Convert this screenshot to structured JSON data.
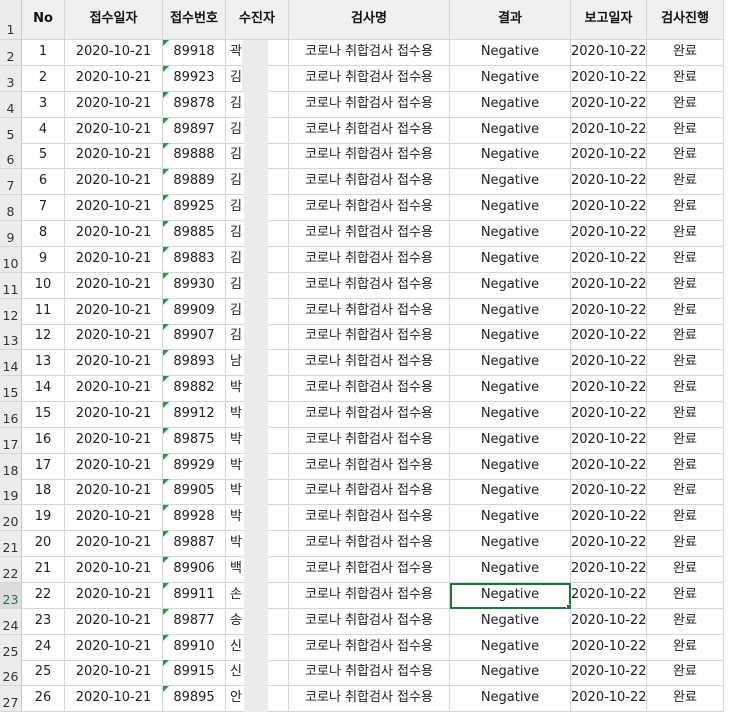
{
  "columns": [
    "No",
    "접수일자",
    "접수번호",
    "수진자",
    "검사명",
    "결과",
    "보고일자",
    "검사진행"
  ],
  "header_row_number": "1",
  "selected_row_number": "23",
  "active_cell": {
    "row": 22,
    "column": "결과"
  },
  "rows": [
    {
      "rownum": "2",
      "no": "1",
      "date": "2020-10-21",
      "id": "89918",
      "name": "곽",
      "test": "코로나 취합검사 접수용",
      "result": "Negative",
      "report": "2020-10-22",
      "status": "완료"
    },
    {
      "rownum": "3",
      "no": "2",
      "date": "2020-10-21",
      "id": "89923",
      "name": "김",
      "test": "코로나 취합검사 접수용",
      "result": "Negative",
      "report": "2020-10-22",
      "status": "완료"
    },
    {
      "rownum": "4",
      "no": "3",
      "date": "2020-10-21",
      "id": "89878",
      "name": "김",
      "test": "코로나 취합검사 접수용",
      "result": "Negative",
      "report": "2020-10-22",
      "status": "완료"
    },
    {
      "rownum": "5",
      "no": "4",
      "date": "2020-10-21",
      "id": "89897",
      "name": "김",
      "test": "코로나 취합검사 접수용",
      "result": "Negative",
      "report": "2020-10-22",
      "status": "완료"
    },
    {
      "rownum": "6",
      "no": "5",
      "date": "2020-10-21",
      "id": "89888",
      "name": "김",
      "test": "코로나 취합검사 접수용",
      "result": "Negative",
      "report": "2020-10-22",
      "status": "완료"
    },
    {
      "rownum": "7",
      "no": "6",
      "date": "2020-10-21",
      "id": "89889",
      "name": "김",
      "test": "코로나 취합검사 접수용",
      "result": "Negative",
      "report": "2020-10-22",
      "status": "완료"
    },
    {
      "rownum": "8",
      "no": "7",
      "date": "2020-10-21",
      "id": "89925",
      "name": "김",
      "test": "코로나 취합검사 접수용",
      "result": "Negative",
      "report": "2020-10-22",
      "status": "완료"
    },
    {
      "rownum": "9",
      "no": "8",
      "date": "2020-10-21",
      "id": "89885",
      "name": "김",
      "test": "코로나 취합검사 접수용",
      "result": "Negative",
      "report": "2020-10-22",
      "status": "완료"
    },
    {
      "rownum": "10",
      "no": "9",
      "date": "2020-10-21",
      "id": "89883",
      "name": "김",
      "test": "코로나 취합검사 접수용",
      "result": "Negative",
      "report": "2020-10-22",
      "status": "완료"
    },
    {
      "rownum": "11",
      "no": "10",
      "date": "2020-10-21",
      "id": "89930",
      "name": "김",
      "test": "코로나 취합검사 접수용",
      "result": "Negative",
      "report": "2020-10-22",
      "status": "완료"
    },
    {
      "rownum": "12",
      "no": "11",
      "date": "2020-10-21",
      "id": "89909",
      "name": "김",
      "test": "코로나 취합검사 접수용",
      "result": "Negative",
      "report": "2020-10-22",
      "status": "완료"
    },
    {
      "rownum": "13",
      "no": "12",
      "date": "2020-10-21",
      "id": "89907",
      "name": "김",
      "test": "코로나 취합검사 접수용",
      "result": "Negative",
      "report": "2020-10-22",
      "status": "완료"
    },
    {
      "rownum": "14",
      "no": "13",
      "date": "2020-10-21",
      "id": "89893",
      "name": "남",
      "test": "코로나 취합검사 접수용",
      "result": "Negative",
      "report": "2020-10-22",
      "status": "완료"
    },
    {
      "rownum": "15",
      "no": "14",
      "date": "2020-10-21",
      "id": "89882",
      "name": "박",
      "test": "코로나 취합검사 접수용",
      "result": "Negative",
      "report": "2020-10-22",
      "status": "완료"
    },
    {
      "rownum": "16",
      "no": "15",
      "date": "2020-10-21",
      "id": "89912",
      "name": "박",
      "test": "코로나 취합검사 접수용",
      "result": "Negative",
      "report": "2020-10-22",
      "status": "완료"
    },
    {
      "rownum": "17",
      "no": "16",
      "date": "2020-10-21",
      "id": "89875",
      "name": "박",
      "test": "코로나 취합검사 접수용",
      "result": "Negative",
      "report": "2020-10-22",
      "status": "완료"
    },
    {
      "rownum": "18",
      "no": "17",
      "date": "2020-10-21",
      "id": "89929",
      "name": "박",
      "test": "코로나 취합검사 접수용",
      "result": "Negative",
      "report": "2020-10-22",
      "status": "완료"
    },
    {
      "rownum": "19",
      "no": "18",
      "date": "2020-10-21",
      "id": "89905",
      "name": "박",
      "test": "코로나 취합검사 접수용",
      "result": "Negative",
      "report": "2020-10-22",
      "status": "완료"
    },
    {
      "rownum": "20",
      "no": "19",
      "date": "2020-10-21",
      "id": "89928",
      "name": "박",
      "test": "코로나 취합검사 접수용",
      "result": "Negative",
      "report": "2020-10-22",
      "status": "완료"
    },
    {
      "rownum": "21",
      "no": "20",
      "date": "2020-10-21",
      "id": "89887",
      "name": "박",
      "test": "코로나 취합검사 접수용",
      "result": "Negative",
      "report": "2020-10-22",
      "status": "완료"
    },
    {
      "rownum": "22",
      "no": "21",
      "date": "2020-10-21",
      "id": "89906",
      "name": "백",
      "test": "코로나 취합검사 접수용",
      "result": "Negative",
      "report": "2020-10-22",
      "status": "완료"
    },
    {
      "rownum": "23",
      "no": "22",
      "date": "2020-10-21",
      "id": "89911",
      "name": "손",
      "test": "코로나 취합검사 접수용",
      "result": "Negative",
      "report": "2020-10-22",
      "status": "완료"
    },
    {
      "rownum": "24",
      "no": "23",
      "date": "2020-10-21",
      "id": "89877",
      "name": "송",
      "test": "코로나 취합검사 접수용",
      "result": "Negative",
      "report": "2020-10-22",
      "status": "완료"
    },
    {
      "rownum": "25",
      "no": "24",
      "date": "2020-10-21",
      "id": "89910",
      "name": "신",
      "test": "코로나 취합검사 접수용",
      "result": "Negative",
      "report": "2020-10-22",
      "status": "완료"
    },
    {
      "rownum": "26",
      "no": "25",
      "date": "2020-10-21",
      "id": "89915",
      "name": "신",
      "test": "코로나 취합검사 접수용",
      "result": "Negative",
      "report": "2020-10-22",
      "status": "완료"
    },
    {
      "rownum": "27",
      "no": "26",
      "date": "2020-10-21",
      "id": "89895",
      "name": "안",
      "test": "코로나 취합검사 접수용",
      "result": "Negative",
      "report": "2020-10-22",
      "status": "완료"
    }
  ],
  "colors": {
    "accent": "#217346",
    "number_marker": "#1f9a3c",
    "header_bg": "#f0f0f0",
    "gridline": "#d6d6d6"
  }
}
